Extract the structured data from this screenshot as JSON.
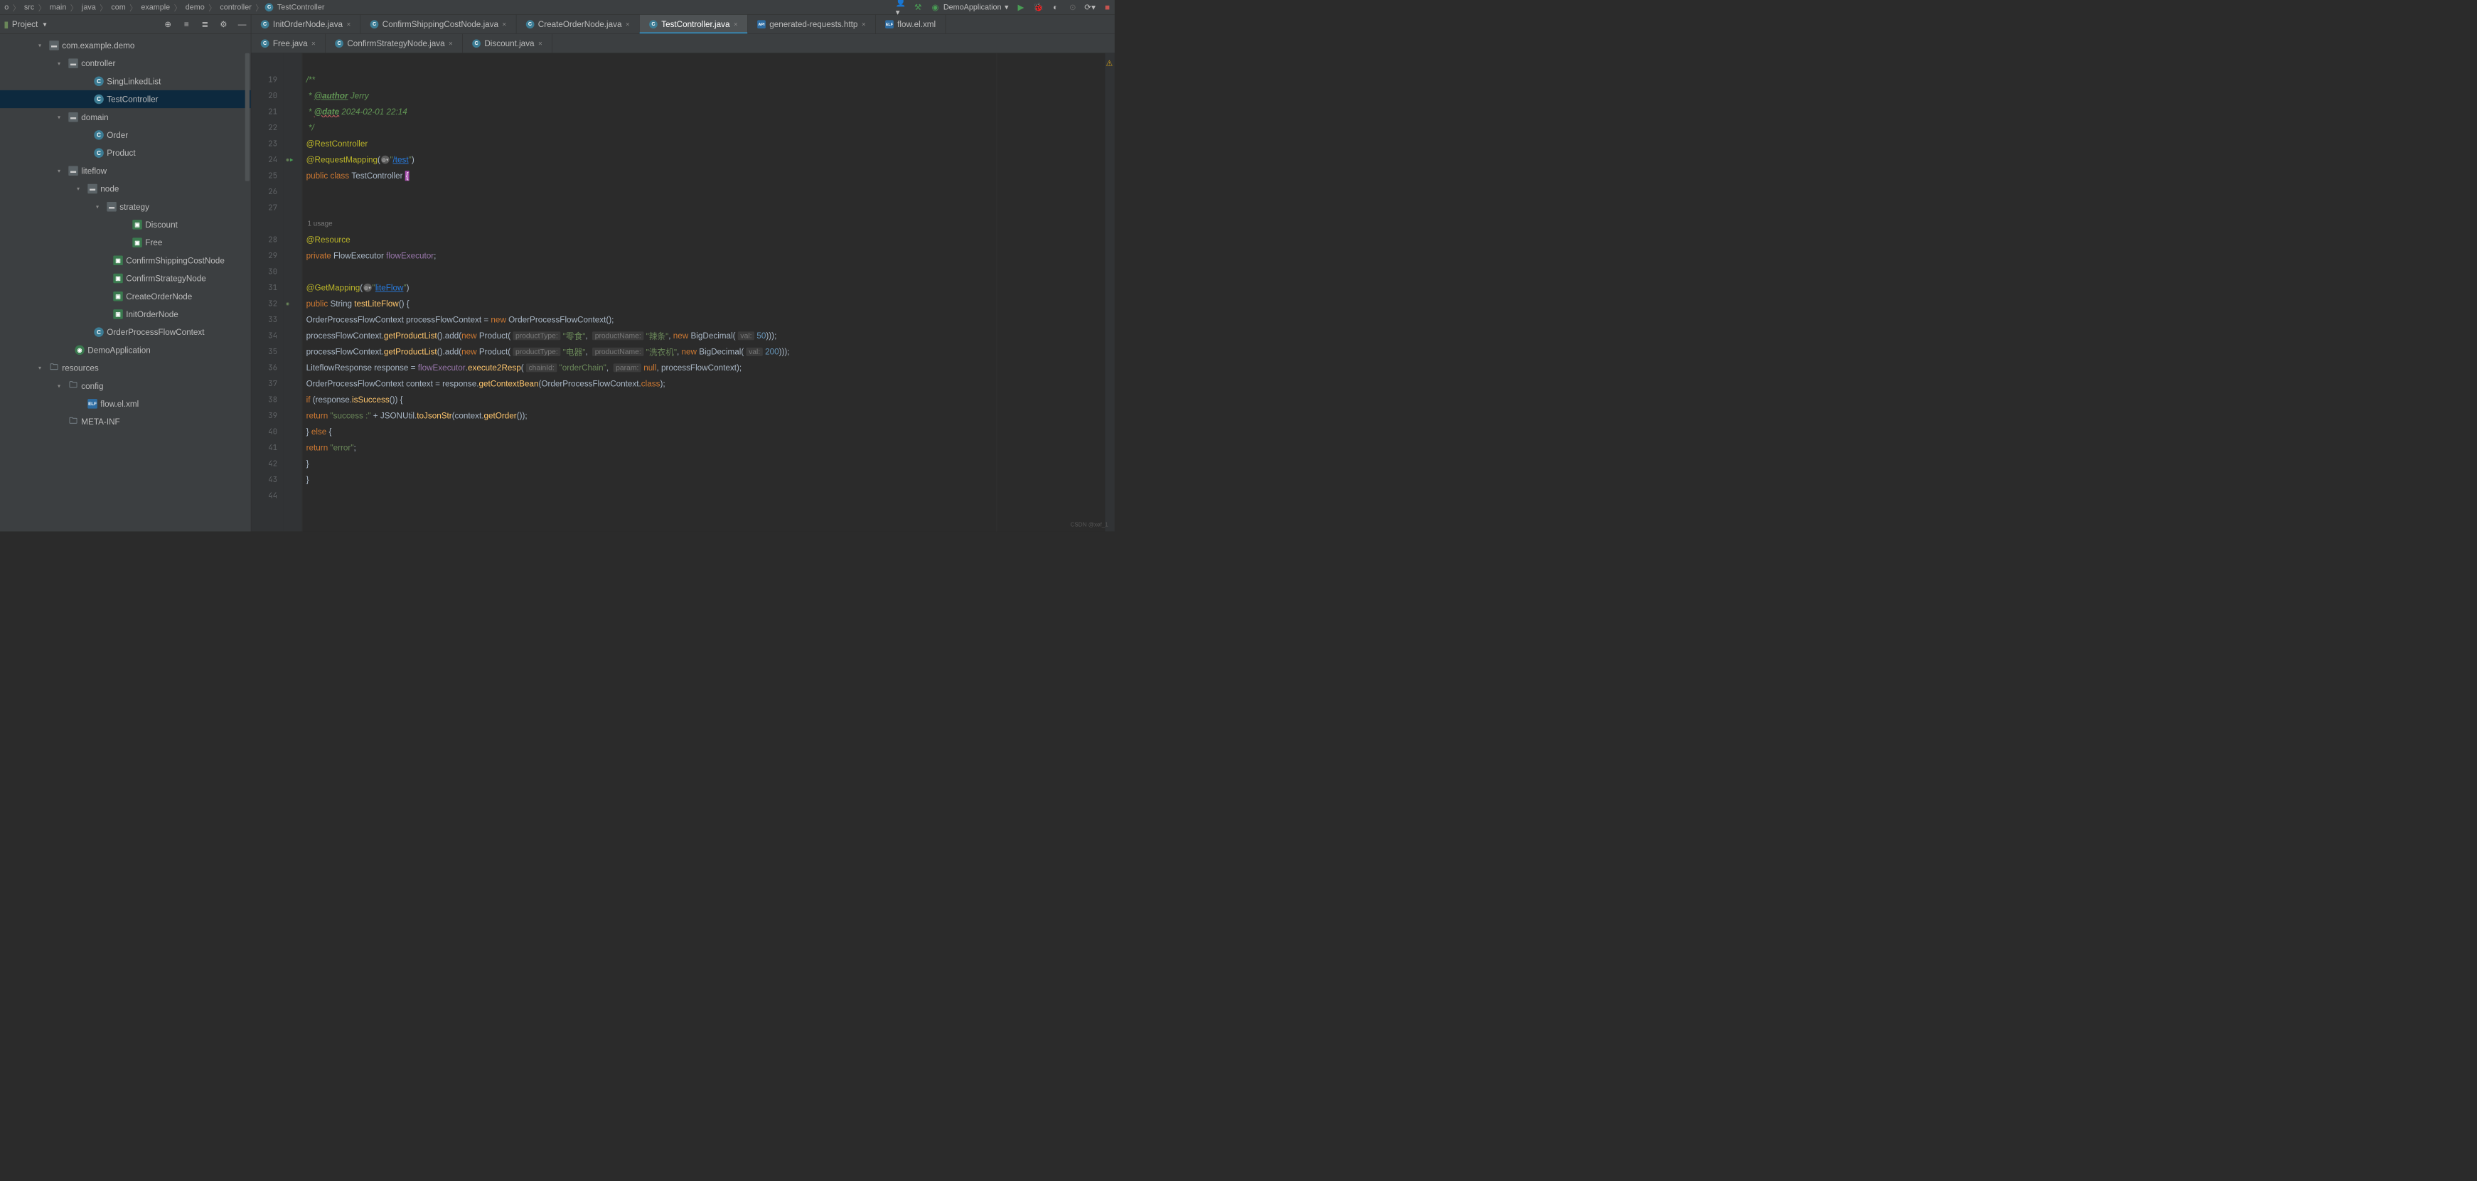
{
  "breadcrumb": [
    "o",
    "src",
    "main",
    "java",
    "com",
    "example",
    "demo",
    "controller",
    "TestController"
  ],
  "run_config": "DemoApplication",
  "project_panel_title": "Project",
  "tree": [
    {
      "label": "com.example.demo",
      "ind": 120,
      "type": "pkg",
      "arrow": "▾"
    },
    {
      "label": "controller",
      "ind": 180,
      "type": "pkg",
      "arrow": "▾"
    },
    {
      "label": "SingLinkedList",
      "ind": 260,
      "type": "cls",
      "arrow": ""
    },
    {
      "label": "TestController",
      "ind": 260,
      "type": "cls",
      "arrow": "",
      "selected": true
    },
    {
      "label": "domain",
      "ind": 180,
      "type": "pkg",
      "arrow": "▾"
    },
    {
      "label": "Order",
      "ind": 260,
      "type": "cls",
      "arrow": ""
    },
    {
      "label": "Product",
      "ind": 260,
      "type": "cls",
      "arrow": ""
    },
    {
      "label": "liteflow",
      "ind": 180,
      "type": "pkg",
      "arrow": "▾"
    },
    {
      "label": "node",
      "ind": 240,
      "type": "pkg",
      "arrow": "▾"
    },
    {
      "label": "strategy",
      "ind": 300,
      "type": "pkg",
      "arrow": "▾"
    },
    {
      "label": "Discount",
      "ind": 380,
      "type": "bean",
      "arrow": ""
    },
    {
      "label": "Free",
      "ind": 380,
      "type": "bean",
      "arrow": ""
    },
    {
      "label": "ConfirmShippingCostNode",
      "ind": 320,
      "type": "bean",
      "arrow": ""
    },
    {
      "label": "ConfirmStrategyNode",
      "ind": 320,
      "type": "bean",
      "arrow": ""
    },
    {
      "label": "CreateOrderNode",
      "ind": 320,
      "type": "bean",
      "arrow": ""
    },
    {
      "label": "InitOrderNode",
      "ind": 320,
      "type": "bean",
      "arrow": ""
    },
    {
      "label": "OrderProcessFlowContext",
      "ind": 260,
      "type": "cls",
      "arrow": ""
    },
    {
      "label": "DemoApplication",
      "ind": 200,
      "type": "app",
      "arrow": ""
    },
    {
      "label": "resources",
      "ind": 120,
      "type": "dir",
      "arrow": "▾"
    },
    {
      "label": "config",
      "ind": 180,
      "type": "dir",
      "arrow": "▾"
    },
    {
      "label": "flow.el.xml",
      "ind": 240,
      "type": "elf",
      "arrow": ""
    },
    {
      "label": "META-INF",
      "ind": 180,
      "type": "dir",
      "arrow": ""
    }
  ],
  "tabs_row1": [
    {
      "label": "InitOrderNode.java",
      "icon": "java"
    },
    {
      "label": "ConfirmShippingCostNode.java",
      "icon": "java"
    },
    {
      "label": "CreateOrderNode.java",
      "icon": "java"
    },
    {
      "label": "TestController.java",
      "icon": "java",
      "active": true
    },
    {
      "label": "generated-requests.http",
      "icon": "http"
    },
    {
      "label": "flow.el.xml",
      "icon": "elf",
      "noclose": true
    }
  ],
  "tabs_row2": [
    {
      "label": "Free.java",
      "icon": "java"
    },
    {
      "label": "ConfirmStrategyNode.java",
      "icon": "java"
    },
    {
      "label": "Discount.java",
      "icon": "java"
    }
  ],
  "line_start": 19,
  "line_end": 44,
  "usage_text": "1 usage",
  "code": {
    "doc_open": "/**",
    "author_tag": "@author",
    "author_val": "Jerry",
    "date_tag": "@date",
    "date_val": "2024-02-01 22:14",
    "doc_close": "*/",
    "ann_rest": "@RestController",
    "ann_rm": "@RequestMapping",
    "rm_path": "/test",
    "cls_name": "TestController",
    "ann_res": "@Resource",
    "fe_type": "FlowExecutor",
    "fe_name": "flowExecutor",
    "ann_get": "@GetMapping",
    "gm_path": "liteFlow",
    "fn_name": "testLiteFlow",
    "ctx_type": "OrderProcessFlowContext",
    "ctx_var": "processFlowContext",
    "getPL": "getProductList",
    "add": "add",
    "prod": "Product",
    "h_ptype": "productType:",
    "h_pname": "productName:",
    "h_val": "val:",
    "v_ptype1": "\"零食\"",
    "v_pname1": "\"辣条\"",
    "v_v1": "50",
    "v_ptype2": "\"电器\"",
    "v_pname2": "\"洗衣机\"",
    "v_v2": "200",
    "bd": "BigDecimal",
    "lf_resp": "LiteflowResponse",
    "resp_var": "response",
    "exec": "execute2Resp",
    "h_chain": "chainId:",
    "v_chain": "\"orderChain\"",
    "h_param": "param:",
    "ctxb": "getContextBean",
    "ctx2": "context",
    "isSucc": "isSuccess",
    "succ_str": "\"success :\"",
    "json": "JSONUtil",
    "tojson": "toJsonStr",
    "getOrder": "getOrder",
    "err_str": "\"error\""
  },
  "watermark": "CSDN @xef_1"
}
